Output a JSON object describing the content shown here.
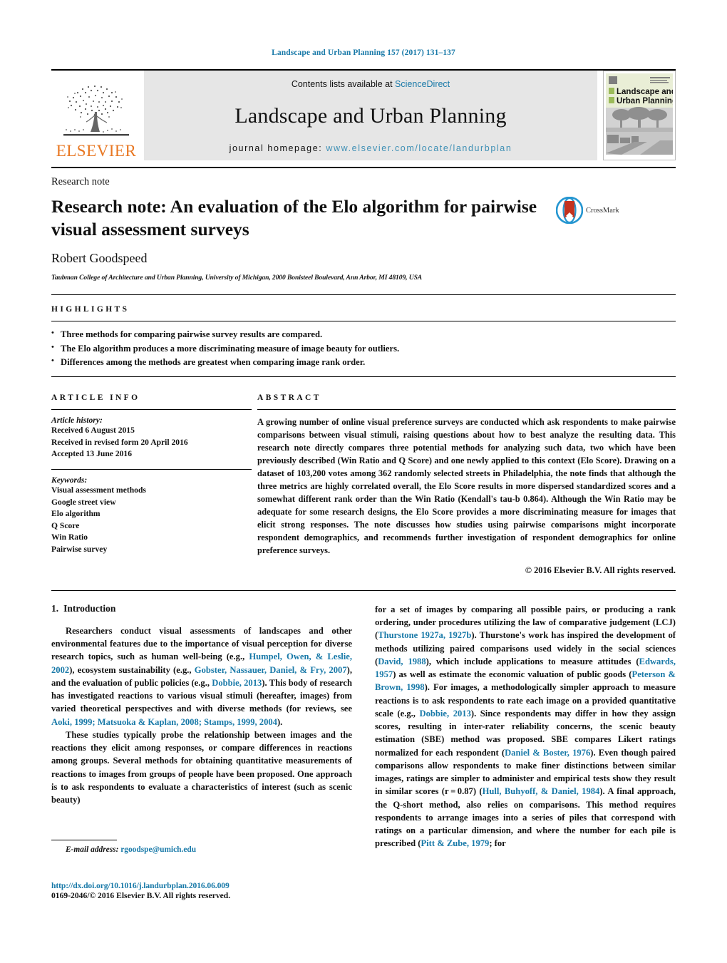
{
  "running_head": "Landscape and Urban Planning 157 (2017) 131–137",
  "masthead": {
    "publisher_name": "ELSEVIER",
    "contents_prefix": "Contents lists available at ",
    "contents_link": "ScienceDirect",
    "journal_title": "Landscape and Urban Planning",
    "homepage_prefix": "journal homepage: ",
    "homepage_url": "www.elsevier.com/locate/landurbplan",
    "cover": {
      "line1": "Landscape and",
      "line2": "Urban Planning"
    }
  },
  "article": {
    "kind": "Research note",
    "title": "Research note: An evaluation of the Elo algorithm for pairwise visual assessment surveys",
    "crossmark_label": "CrossMark",
    "author": "Robert Goodspeed",
    "affiliation": "Taubman College of Architecture and Urban Planning, University of Michigan, 2000 Bonisteel Boulevard, Ann Arbor, MI 48109, USA"
  },
  "highlights": {
    "heading": "HIGHLIGHTS",
    "items": [
      "Three methods for comparing pairwise survey results are compared.",
      "The Elo algorithm produces a more discriminating measure of image beauty for outliers.",
      "Differences among the methods are greatest when comparing image rank order."
    ]
  },
  "article_info": {
    "heading": "ARTICLE INFO",
    "history_label": "Article history:",
    "history": [
      "Received 6 August 2015",
      "Received in revised form 20 April 2016",
      "Accepted 13 June 2016"
    ],
    "keywords_label": "Keywords:",
    "keywords": [
      "Visual assessment methods",
      "Google street view",
      "Elo algorithm",
      "Q Score",
      "Win Ratio",
      "Pairwise survey"
    ]
  },
  "abstract": {
    "heading": "ABSTRACT",
    "text": "A growing number of online visual preference surveys are conducted which ask respondents to make pairwise comparisons between visual stimuli, raising questions about how to best analyze the resulting data. This research note directly compares three potential methods for analyzing such data, two which have been previously described (Win Ratio and Q Score) and one newly applied to this context (Elo Score). Drawing on a dataset of 103,200 votes among 362 randomly selected streets in Philadelphia, the note finds that although the three metrics are highly correlated overall, the Elo Score results in more dispersed standardized scores and a somewhat different rank order than the Win Ratio (Kendall's tau-b 0.864). Although the Win Ratio may be adequate for some research designs, the Elo Score provides a more discriminating measure for images that elicit strong responses. The note discusses how studies using pairwise comparisons might incorporate respondent demographics, and recommends further investigation of respondent demographics for online preference surveys.",
    "copyright": "© 2016 Elsevier B.V. All rights reserved."
  },
  "body": {
    "section_number": "1.",
    "section_title": "Introduction",
    "left_paragraphs": [
      {
        "parts": [
          {
            "t": "Researchers conduct visual assessments of landscapes and other environmental features due to the importance of visual perception for diverse research topics, such as human well-being (e.g., ",
            "ref": false
          },
          {
            "t": "Humpel, Owen, & Leslie, 2002",
            "ref": true
          },
          {
            "t": "), ecosystem sustainability (e.g., ",
            "ref": false
          },
          {
            "t": "Gobster, Nassauer, Daniel, & Fry, 2007",
            "ref": true
          },
          {
            "t": "), and the evaluation of public policies (e.g., ",
            "ref": false
          },
          {
            "t": "Dobbie, 2013",
            "ref": true
          },
          {
            "t": "). This body of research has investigated reactions to various visual stimuli (hereafter, images) from varied theoretical perspectives and with diverse methods (for reviews, see ",
            "ref": false
          },
          {
            "t": "Aoki, 1999; Matsuoka & Kaplan, 2008; Stamps, 1999, 2004",
            "ref": true
          },
          {
            "t": ").",
            "ref": false
          }
        ]
      },
      {
        "parts": [
          {
            "t": "These studies typically probe the relationship between images and the reactions they elicit among responses, or compare differences in reactions among groups. Several methods for obtaining quantitative measurements of reactions to images from groups of people have been proposed. One approach is to ask respondents to evaluate a characteristics of interest (such as scenic beauty)",
            "ref": false
          }
        ]
      }
    ],
    "right_paragraphs": [
      {
        "parts": [
          {
            "t": "for a set of images by comparing all possible pairs, or producing a rank ordering, under procedures utilizing the law of comparative judgement (LCJ) (",
            "ref": false
          },
          {
            "t": "Thurstone 1927a, 1927b",
            "ref": true
          },
          {
            "t": "). Thurstone's work has inspired the development of methods utilizing paired comparisons used widely in the social sciences (",
            "ref": false
          },
          {
            "t": "David, 1988",
            "ref": true
          },
          {
            "t": "), which include applications to measure attitudes (",
            "ref": false
          },
          {
            "t": "Edwards, 1957",
            "ref": true
          },
          {
            "t": ") as well as estimate the economic valuation of public goods (",
            "ref": false
          },
          {
            "t": "Peterson & Brown, 1998",
            "ref": true
          },
          {
            "t": "). For images, a methodologically simpler approach to measure reactions is to ask respondents to rate each image on a provided quantitative scale (e.g., ",
            "ref": false
          },
          {
            "t": "Dobbie, 2013",
            "ref": true
          },
          {
            "t": "). Since respondents may differ in how they assign scores, resulting in inter-rater reliability concerns, the scenic beauty estimation (SBE) method was proposed. SBE compares Likert ratings normalized for each respondent (",
            "ref": false
          },
          {
            "t": "Daniel & Boster, 1976",
            "ref": true
          },
          {
            "t": "). Even though paired comparisons allow respondents to make finer distinctions between similar images, ratings are simpler to administer and empirical tests show they result in similar scores (r = 0.87) (",
            "ref": false
          },
          {
            "t": "Hull, Buhyoff, & Daniel, 1984",
            "ref": true
          },
          {
            "t": "). A final approach, the Q-short method, also relies on comparisons. This method requires respondents to arrange images into a series of piles that correspond with ratings on a particular dimension, and where the number for each pile is prescribed (",
            "ref": false
          },
          {
            "t": "Pitt & Zube, 1979",
            "ref": true
          },
          {
            "t": "; for",
            "ref": false
          }
        ]
      }
    ]
  },
  "footer": {
    "email_label": "E-mail address:",
    "email": "rgoodspe@umich.edu",
    "doi": "http://dx.doi.org/10.1016/j.landurbplan.2016.06.009",
    "issn_copyright": "0169-2046/© 2016 Elsevier B.V. All rights reserved."
  },
  "colors": {
    "link": "#1879a8",
    "homepage_link": "#3f90b5",
    "elsevier_orange": "#e87722",
    "masthead_bg": "#e6e6e6",
    "crossmark_red": "#c4321f",
    "crossmark_blue": "#2596d1"
  }
}
